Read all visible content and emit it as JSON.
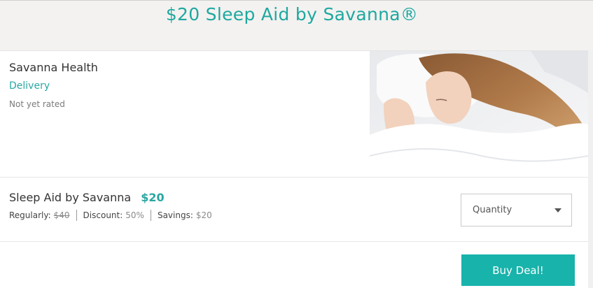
{
  "page": {
    "title": "$20 Sleep Aid by Savanna®"
  },
  "vendor": {
    "name": "Savanna Health",
    "delivery_link": "Delivery",
    "rating": "Not yet rated"
  },
  "product": {
    "name": "Sleep Aid by Savanna",
    "price": "$20",
    "regular_label": "Regularly:",
    "regular_value": "$40",
    "discount_label": "Discount:",
    "discount_value": "50%",
    "savings_label": "Savings:",
    "savings_value": "$20"
  },
  "quantity": {
    "label": "Quantity",
    "icon": "caret-down-icon"
  },
  "buy": {
    "label": "Buy Deal!"
  },
  "colors": {
    "accent": "#1fa8a0",
    "button": "#18b3ab"
  }
}
